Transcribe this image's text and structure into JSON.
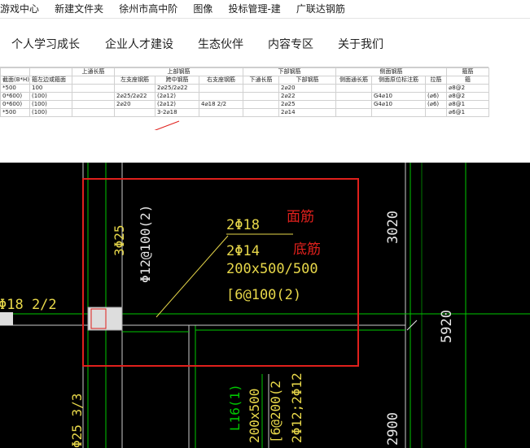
{
  "bookmarks": [
    "游戏中心",
    "新建文件夹",
    "徐州市高中阶",
    "图像",
    "投标管理-建",
    "广联达钢筋"
  ],
  "nav": [
    "个人学习成长",
    "企业人才建设",
    "生态伙伴",
    "内容专区",
    "关于我们"
  ],
  "table": {
    "group_headers": {
      "upper": "上部钢筋",
      "lower": "下部钢筋",
      "side": "侧面钢筋",
      "top_through": "上通长筋",
      "stirrup": "箍筋"
    },
    "columns": [
      "截面(B*H)",
      "箍左边或箍面",
      "左支座钢筋",
      "跨中钢筋",
      "右支座钢筋",
      "下通长筋",
      "下部钢筋",
      "侧面通长筋",
      "侧面原位标注筋",
      "拉筋",
      "箍"
    ],
    "rows": [
      [
        "*500",
        "100",
        "",
        "2⌀25/2⌀22",
        "",
        "",
        "2⌀20",
        "",
        "",
        "",
        "⌀8@2"
      ],
      [
        "0*600)",
        "(100)",
        "2⌀25/2⌀22",
        "(2⌀12)",
        "",
        "",
        "2⌀22",
        "",
        "G4⌀10",
        "(⌀6)",
        "⌀8@2"
      ],
      [
        "0*600)",
        "(100)",
        "2⌀20",
        "(2⌀12)",
        "4⌀18 2/2",
        "",
        "2⌀25",
        "",
        "G4⌀10",
        "(⌀6)",
        "⌀8@1"
      ],
      [
        "*500",
        "(100)",
        "",
        "3-2⌀18",
        "",
        "",
        "2⌀14",
        "",
        "",
        "",
        "⌀6@1"
      ]
    ]
  },
  "cad": {
    "annotations": {
      "top_bar": "2Φ18",
      "bottom_bar": "2Φ14",
      "section": "200x500/500",
      "stirrup": "[6@100(2)",
      "left_col": "3Φ25",
      "left_col2": "Φ12@100(2)",
      "left_edge": "Φ18 2/2",
      "beam_name": "L16(1)",
      "beam_sec": "200x500",
      "beam_stirrup": "[6@200(2",
      "beam_bar": "2Φ12;2Φ12",
      "bottom_left": "Φ25 3/3",
      "dim_top": "3020",
      "dim_mid": "5920",
      "dim_bottom": "2900"
    },
    "labels": {
      "face_bar": "面筋",
      "bottom_bar": "底筋"
    },
    "colors": {
      "background": "#000000",
      "rebar_text": "#e8d84a",
      "grid_line": "#00c800",
      "highlight_box": "#e0201c",
      "dimension": "#e6e6e6"
    }
  }
}
